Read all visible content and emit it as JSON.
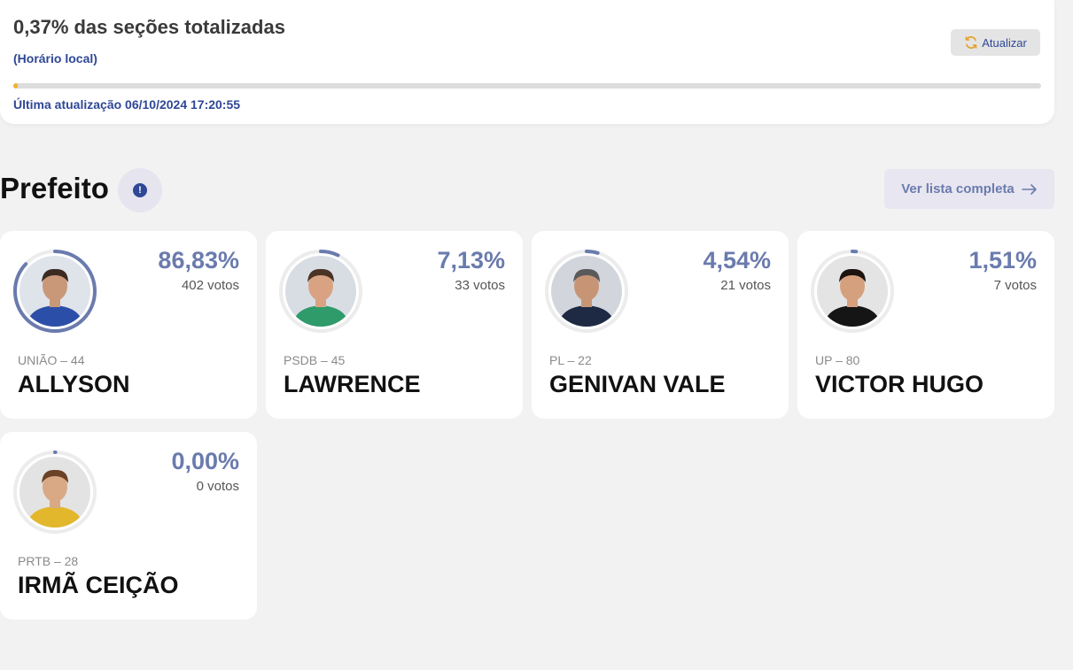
{
  "status": {
    "title": "0,37% das seções totalizadas",
    "subtitle": "(Horário local)",
    "refresh_label": "Atualizar",
    "progress": 0.0037,
    "last_update": "Última atualização 06/10/2024 17:20:55"
  },
  "section": {
    "title": "Prefeito",
    "info_icon": "!",
    "full_list_label": "Ver lista completa"
  },
  "colors": {
    "accent": "#6a7bad",
    "link": "#2e4796",
    "progress": "#f0b429"
  },
  "candidates": [
    {
      "party": "UNIÃO – 44",
      "name": "ALLYSON",
      "pct": "86,83%",
      "votes": "402 votos",
      "share": 0.8683,
      "shirt": "#2b4ea8",
      "skin": "#c89878",
      "hair": "#3a2a22",
      "bg": "#dfe3ea"
    },
    {
      "party": "PSDB – 45",
      "name": "LAWRENCE",
      "pct": "7,13%",
      "votes": "33 votos",
      "share": 0.0713,
      "shirt": "#2f9a6a",
      "skin": "#d9a383",
      "hair": "#4a3324",
      "bg": "#d8dde4"
    },
    {
      "party": "PL – 22",
      "name": "GENIVAN VALE",
      "pct": "4,54%",
      "votes": "21 votos",
      "share": 0.0454,
      "shirt": "#1e2a44",
      "skin": "#c79576",
      "hair": "#5a5a5a",
      "bg": "#d2d6dc"
    },
    {
      "party": "UP – 80",
      "name": "VICTOR HUGO",
      "pct": "1,51%",
      "votes": "7 votos",
      "share": 0.0151,
      "shirt": "#151515",
      "skin": "#d4a07e",
      "hair": "#1e140f",
      "bg": "#e4e4e4"
    },
    {
      "party": "PRTB – 28",
      "name": "IRMÃ CEIÇÃO",
      "pct": "0,00%",
      "votes": "0 votos",
      "share": 0.0,
      "shirt": "#e2b72c",
      "skin": "#d9a885",
      "hair": "#6b4226",
      "bg": "#e3e3e3"
    }
  ]
}
